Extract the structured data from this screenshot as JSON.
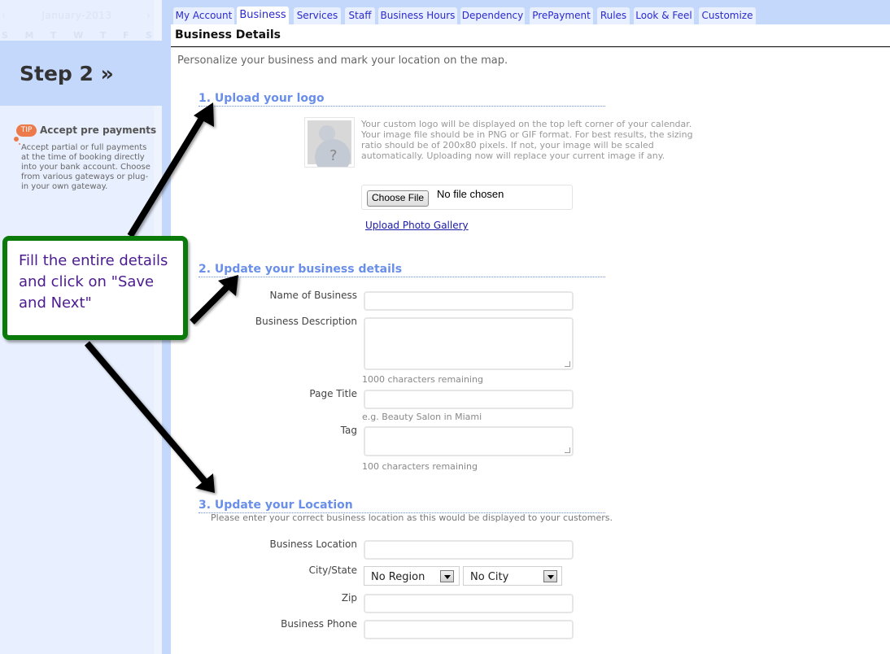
{
  "sidebar": {
    "calendar_month": "January-2013",
    "calendar_days": [
      "S",
      "M",
      "T",
      "W",
      "T",
      "F",
      "S"
    ],
    "step_title": "Step 2 »",
    "tip": {
      "badge": "TIP",
      "title": "Accept pre payments",
      "text": "Accept partial or full payments at the time of booking directly into your bank account. Choose from various gateways or plug-in your own gateway."
    }
  },
  "tabs": [
    {
      "label": "My Account",
      "active": false
    },
    {
      "label": "Business",
      "active": true
    },
    {
      "label": "Services",
      "active": false
    },
    {
      "label": "Staff",
      "active": false
    },
    {
      "label": "Business Hours",
      "active": false
    },
    {
      "label": "Dependency",
      "active": false
    },
    {
      "label": "PrePayment",
      "active": false
    },
    {
      "label": "Rules",
      "active": false
    },
    {
      "label": "Look & Feel",
      "active": false
    },
    {
      "label": "Customize",
      "active": false
    }
  ],
  "page": {
    "title": "Business Details",
    "intro": "Personalize your business and mark your location on the map."
  },
  "logo_section": {
    "heading": "1. Upload your logo",
    "description": "Your custom logo will be displayed on the top left corner of your calendar. Your image file should be in PNG or GIF format. For best results, the sizing ratio should be of 200x80 pixels. If not, your image will be scaled automatically. Uploading now will replace your current image if any.",
    "choose_file_label": "Choose File",
    "file_status": "No file chosen",
    "gallery_link": "Upload Photo Gallery",
    "placeholder_icon": "unknown-person-icon"
  },
  "details_section": {
    "heading": "2. Update your business details",
    "name_label": "Name of Business",
    "name_value": "",
    "description_label": "Business Description",
    "description_value": "",
    "description_hint": "1000 characters remaining",
    "page_title_label": "Page Title",
    "page_title_value": "",
    "page_title_hint": "e.g. Beauty Salon in Miami",
    "tag_label": "Tag",
    "tag_value": "",
    "tag_hint": "100 characters remaining"
  },
  "location_section": {
    "heading": "3. Update your Location",
    "subtext": "Please enter your correct business location as this would be displayed to your customers.",
    "location_label": "Business Location",
    "location_value": "",
    "city_state_label": "City/State",
    "region_selected": "No Region",
    "city_selected": "No City",
    "zip_label": "Zip",
    "zip_value": "",
    "phone_label": "Business Phone",
    "phone_value": ""
  },
  "annotation": {
    "callout_text": "Fill the entire details and click on \"Save and Next\"",
    "border_color": "#0a7a0a",
    "text_color": "#4b1b8f"
  },
  "colors": {
    "sidebar_bg": "#e8effe",
    "accent_blue": "#c4d8fb",
    "heading_blue": "#6a8fe8",
    "tip_orange": "#ec7a4a",
    "tab_text": "#2a2ad0"
  }
}
